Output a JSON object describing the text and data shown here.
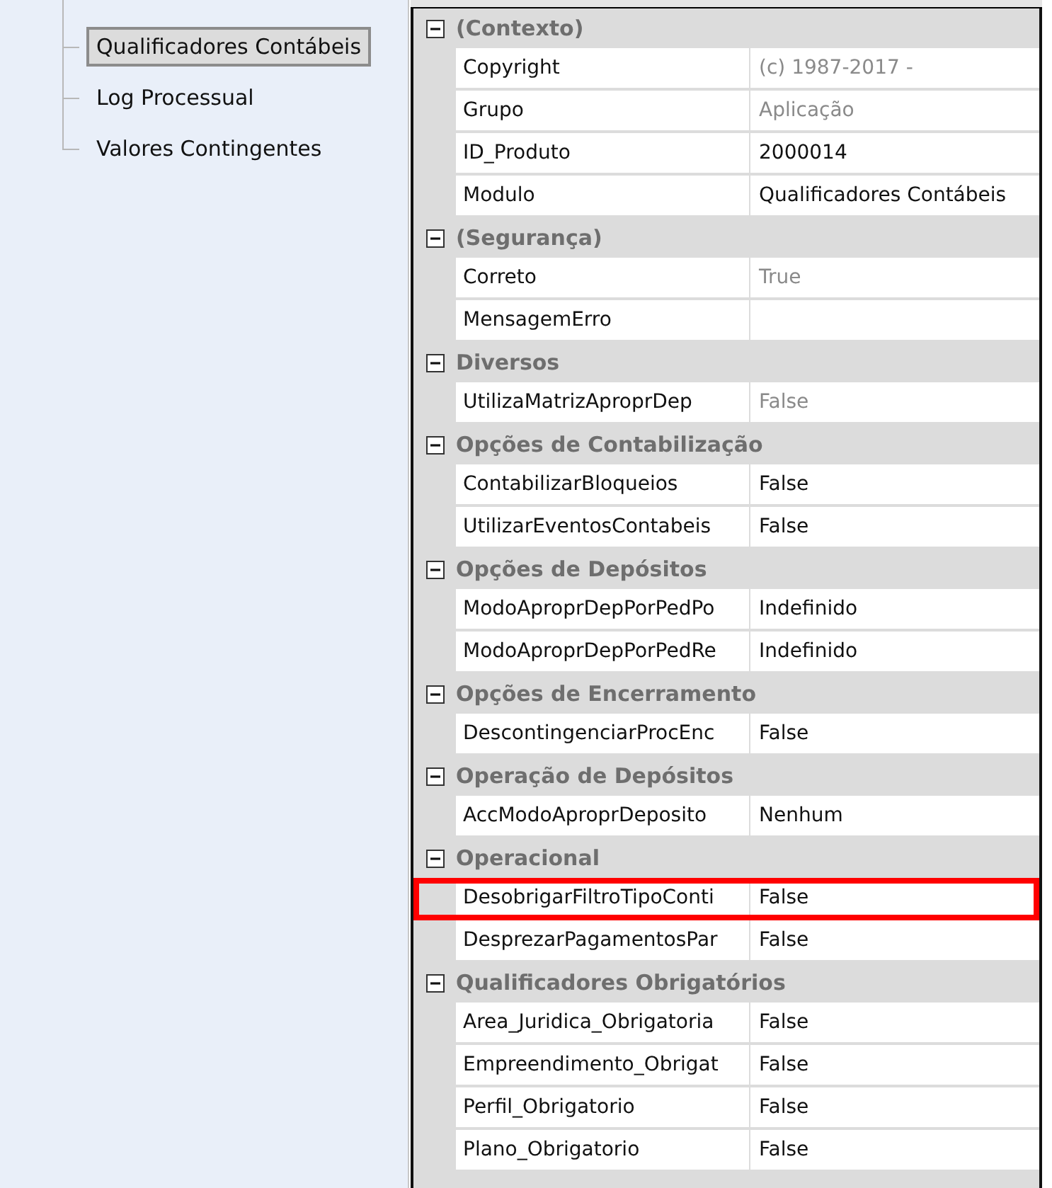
{
  "tree": {
    "items": [
      {
        "label": "Qualificadores Contábeis",
        "selected": true
      },
      {
        "label": "Log Processual",
        "selected": false
      },
      {
        "label": "Valores Contingentes",
        "selected": false
      }
    ]
  },
  "property_grid": {
    "categories": [
      {
        "title": "(Contexto)",
        "expanded": true,
        "properties": [
          {
            "name": "Copyright",
            "value": "(c) 1987-2017 -",
            "readonly": true,
            "highlighted": false
          },
          {
            "name": "Grupo",
            "value": "Aplicação",
            "readonly": true,
            "highlighted": false
          },
          {
            "name": "ID_Produto",
            "value": "2000014",
            "readonly": false,
            "highlighted": false
          },
          {
            "name": "Modulo",
            "value": "Qualificadores Contábeis",
            "readonly": false,
            "highlighted": false
          }
        ]
      },
      {
        "title": "(Segurança)",
        "expanded": true,
        "properties": [
          {
            "name": "Correto",
            "value": "True",
            "readonly": true,
            "highlighted": false
          },
          {
            "name": "MensagemErro",
            "readonly": false,
            "highlighted": false
          }
        ]
      },
      {
        "title": "Diversos",
        "expanded": true,
        "properties": [
          {
            "name": "UtilizaMatrizAproprDep",
            "value": "False",
            "readonly": true,
            "highlighted": false
          }
        ]
      },
      {
        "title": "Opções de Contabilização",
        "expanded": true,
        "properties": [
          {
            "name": "ContabilizarBloqueios",
            "value": "False",
            "readonly": false,
            "highlighted": false
          },
          {
            "name": "UtilizarEventosContabeis",
            "value": "False",
            "readonly": false,
            "highlighted": false
          }
        ]
      },
      {
        "title": "Opções de Depósitos",
        "expanded": true,
        "properties": [
          {
            "name": "ModoAproprDepPorPedPo",
            "value": "Indefinido",
            "readonly": false,
            "highlighted": false
          },
          {
            "name": "ModoAproprDepPorPedRe",
            "value": "Indefinido",
            "readonly": false,
            "highlighted": false
          }
        ]
      },
      {
        "title": "Opções de Encerramento",
        "expanded": true,
        "properties": [
          {
            "name": "DescontingenciarProcEnc",
            "value": "False",
            "readonly": false,
            "highlighted": false
          }
        ]
      },
      {
        "title": "Operação de Depósitos",
        "expanded": true,
        "properties": [
          {
            "name": "AccModoAproprDeposito",
            "value": "Nenhum",
            "readonly": false,
            "highlighted": false
          }
        ]
      },
      {
        "title": "Operacional",
        "expanded": true,
        "properties": [
          {
            "name": "DesobrigarFiltroTipoConti",
            "value": "False",
            "readonly": false,
            "highlighted": true
          },
          {
            "name": "DesprezarPagamentosPar",
            "value": "False",
            "readonly": false,
            "highlighted": false
          }
        ]
      },
      {
        "title": "Qualificadores Obrigatórios",
        "expanded": true,
        "properties": [
          {
            "name": "Area_Juridica_Obrigatoria",
            "value": "False",
            "readonly": false,
            "highlighted": false
          },
          {
            "name": "Empreendimento_Obrigat",
            "value": "False",
            "readonly": false,
            "highlighted": false
          },
          {
            "name": "Perfil_Obrigatorio",
            "value": "False",
            "readonly": false,
            "highlighted": false
          },
          {
            "name": "Plano_Obrigatorio",
            "value": "False",
            "readonly": false,
            "highlighted": false
          }
        ]
      }
    ]
  }
}
